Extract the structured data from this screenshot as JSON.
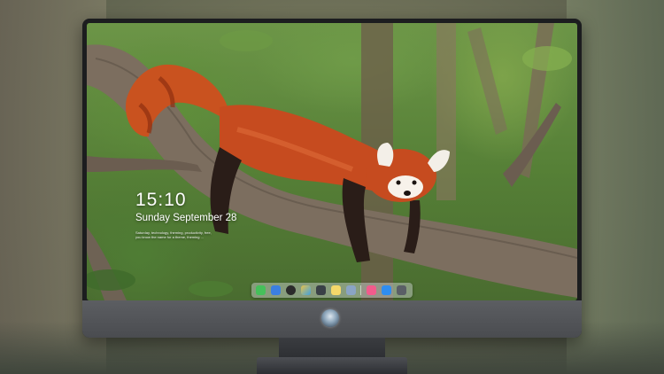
{
  "lockscreen": {
    "time": "15:10",
    "date": "Sunday September 28",
    "note_line1": "Saturday, technology, theming, productivity, free,",
    "note_line2": "you know the name for a theme, theming ..."
  },
  "dock": {
    "icons": [
      {
        "name": "messages-icon",
        "color": "#45c05a"
      },
      {
        "name": "finder-icon",
        "color": "#3b7fe0"
      },
      {
        "name": "launchpad-icon",
        "color": "#2b2b2b"
      },
      {
        "name": "photos-icon",
        "color": "#e6c24a"
      },
      {
        "name": "clapper-icon",
        "color": "#394046"
      },
      {
        "name": "notes-icon",
        "color": "#f4d86a"
      },
      {
        "name": "preview-icon",
        "color": "#8aa4c4"
      },
      {
        "name": "music-icon",
        "color": "#f25b8c"
      },
      {
        "name": "app-store-icon",
        "color": "#2f8df0"
      },
      {
        "name": "folder-icon",
        "color": "#5a5f66"
      }
    ]
  },
  "colors": {
    "fur": "#c64b1f",
    "fur_dark": "#8f2f10",
    "branch": "#7a6c5c",
    "monitor_frame": "#1c1d1f",
    "monitor_chin": "#55575b"
  }
}
